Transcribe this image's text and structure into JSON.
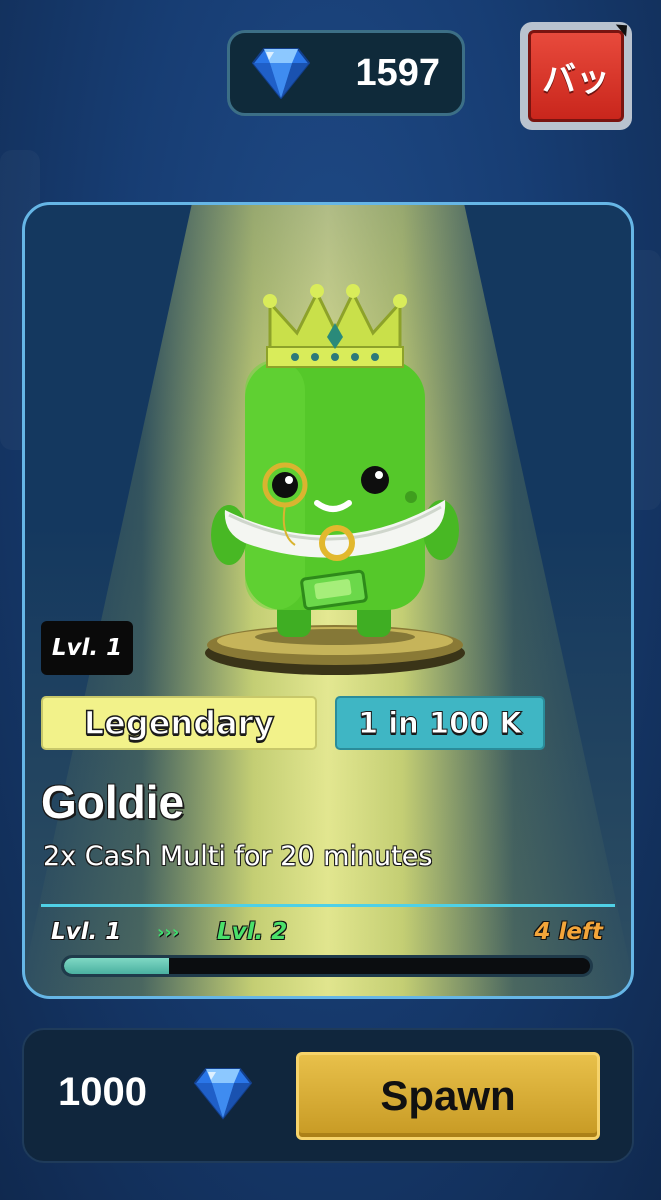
{
  "header": {
    "gem_count": "1597",
    "gem_icon": "diamond-gem-icon",
    "close_label": "バッ"
  },
  "card": {
    "level_badge": "Lvl. 1",
    "rarity": "Legendary",
    "chance": "1 in 100 K",
    "name": "Goldie",
    "description": "2x Cash Multi for 20 minutes",
    "progress": {
      "from_label": "Lvl. 1",
      "arrows": "›››",
      "to_label": "Lvl. 2",
      "remaining_label": "4 left",
      "fraction": 0.2
    }
  },
  "footer": {
    "cost": "1000",
    "cost_icon": "diamond-gem-icon",
    "spawn_label": "Spawn"
  },
  "colors": {
    "background": "#173d73",
    "card_border": "#66b6e6",
    "rarity_legendary": "#f2f28a",
    "chance_tag": "#3fb6c4",
    "spawn_button": "#d9ad34",
    "close_button": "#d8342a",
    "progress_fill": "#6cc8b6"
  }
}
